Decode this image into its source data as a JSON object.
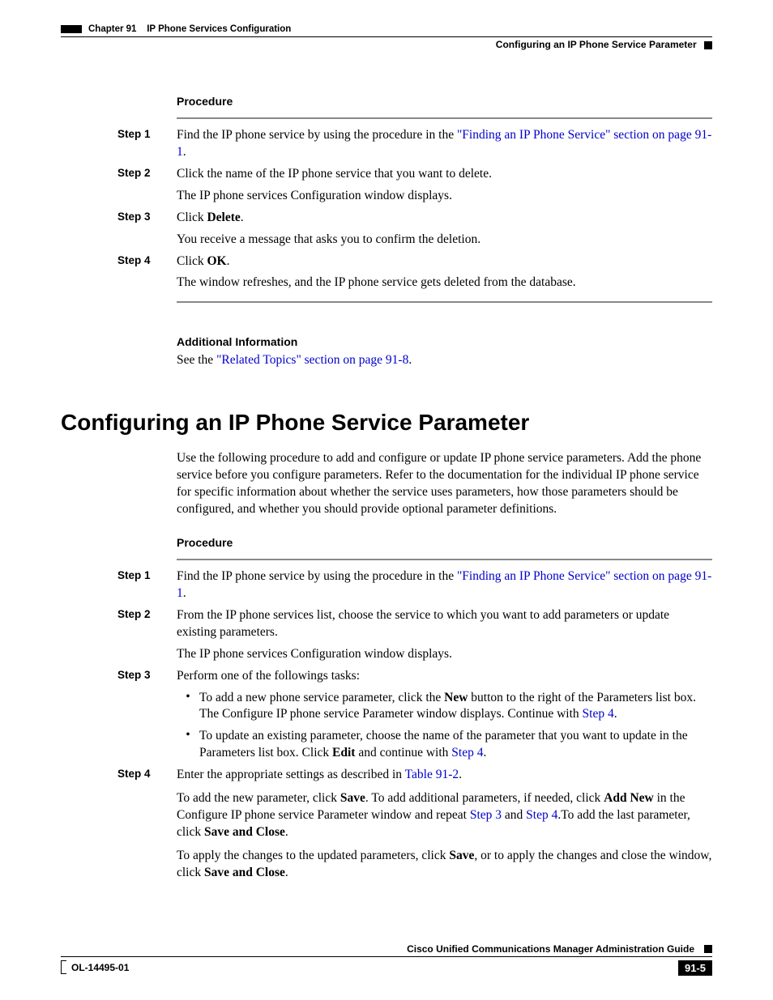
{
  "header": {
    "chapter": "Chapter 91",
    "chapterTitle": "IP Phone Services Configuration",
    "section": "Configuring an IP Phone Service Parameter"
  },
  "proc1": {
    "label": "Procedure",
    "step1_label": "Step 1",
    "step1_a": "Find the IP phone service by using the procedure in the ",
    "step1_link": "\"Finding an IP Phone Service\" section on page 91-1",
    "step1_b": ".",
    "step2_label": "Step 2",
    "step2": "Click the name of the IP phone service that you want to delete.",
    "step2_cont": "The IP phone services Configuration window displays.",
    "step3_label": "Step 3",
    "step3_a": "Click ",
    "step3_bold": "Delete",
    "step3_b": ".",
    "step3_cont": "You receive a message that asks you to confirm the deletion.",
    "step4_label": "Step 4",
    "step4_a": "Click ",
    "step4_bold": "OK",
    "step4_b": ".",
    "step4_cont": "The window refreshes, and the IP phone service gets deleted from the database."
  },
  "addl": {
    "label": "Additional Information",
    "text_a": "See the ",
    "link": "\"Related Topics\" section on page 91-8",
    "text_b": "."
  },
  "h1": "Configuring an IP Phone Service Parameter",
  "intro": "Use the following procedure to add and configure or update IP phone service parameters. Add the phone service before you configure parameters. Refer to the documentation for the individual IP phone service for specific information about whether the service uses parameters, how those parameters should be configured, and whether you should provide optional parameter definitions.",
  "proc2": {
    "label": "Procedure",
    "step1_label": "Step 1",
    "step1_a": "Find the IP phone service by using the procedure in the ",
    "step1_link": "\"Finding an IP Phone Service\" section on page 91-1",
    "step1_b": ".",
    "step2_label": "Step 2",
    "step2": "From the IP phone services list, choose the service to which you want to add parameters or update existing parameters.",
    "step2_cont": "The IP phone services Configuration window displays.",
    "step3_label": "Step 3",
    "step3": "Perform one of the followings tasks:",
    "bullet1_a": "To add a new phone service parameter, click the ",
    "bullet1_bold": "New",
    "bullet1_b": " button to the right of the Parameters list box. The Configure IP phone service Parameter window displays. Continue with ",
    "bullet1_link": "Step 4",
    "bullet1_c": ".",
    "bullet2_a": "To update an existing parameter, choose the name of the parameter that you want to update in the Parameters list box. Click ",
    "bullet2_bold": "Edit",
    "bullet2_b": " and continue with ",
    "bullet2_link": "Step 4",
    "bullet2_c": ".",
    "step4_label": "Step 4",
    "step4_a": "Enter the appropriate settings as described in ",
    "step4_link": "Table 91-2",
    "step4_b": ".",
    "step4_p2_a": "To add the new parameter, click ",
    "step4_p2_bold1": "Save",
    "step4_p2_b": ". To add additional parameters, if needed, click ",
    "step4_p2_bold2": "Add New",
    "step4_p2_c": " in the Configure IP phone service Parameter window and repeat ",
    "step4_p2_link1": "Step 3",
    "step4_p2_d": " and ",
    "step4_p2_link2": "Step 4",
    "step4_p2_e": ".To add the last parameter, click ",
    "step4_p2_bold3": "Save and Close",
    "step4_p2_f": ".",
    "step4_p3_a": "To apply the changes to the updated parameters, click ",
    "step4_p3_bold1": "Save",
    "step4_p3_b": ", or to apply the changes and close the window, click ",
    "step4_p3_bold2": "Save and Close",
    "step4_p3_c": "."
  },
  "footer": {
    "guide": "Cisco Unified Communications Manager Administration Guide",
    "docnum": "OL-14495-01",
    "pagenum": "91-5"
  }
}
